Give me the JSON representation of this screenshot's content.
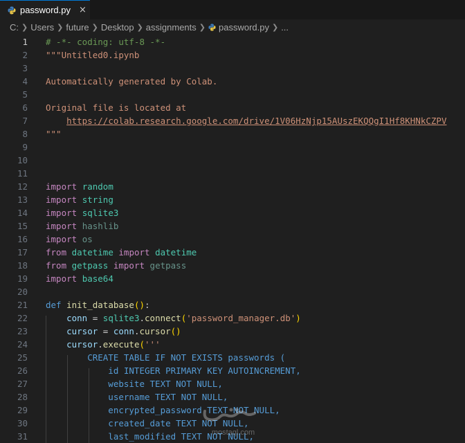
{
  "tab": {
    "filename": "password.py",
    "close_glyph": "×"
  },
  "breadcrumb": [
    "C:",
    "Users",
    "future",
    "Desktop",
    "assignments",
    "password.py",
    "..."
  ],
  "watermark_text": "mostaql.com",
  "colors": {
    "accent": "#0078d4",
    "comment": "#6a9955",
    "string": "#ce9178",
    "keyword": "#c586c0",
    "def": "#569cd6",
    "module": "#4ec9b0",
    "function": "#dcdcaa",
    "variable": "#9cdcfe"
  },
  "lines": [
    {
      "n": "1",
      "tokens": [
        {
          "t": "# -*- coding: utf-8 -*-",
          "c": "c-comment"
        }
      ]
    },
    {
      "n": "2",
      "tokens": [
        {
          "t": "\"\"\"Untitled0.ipynb",
          "c": "c-string"
        }
      ]
    },
    {
      "n": "3",
      "tokens": []
    },
    {
      "n": "4",
      "tokens": [
        {
          "t": "Automatically generated by Colab.",
          "c": "c-string"
        }
      ]
    },
    {
      "n": "5",
      "tokens": []
    },
    {
      "n": "6",
      "tokens": [
        {
          "t": "Original file is located at",
          "c": "c-string"
        }
      ]
    },
    {
      "n": "7",
      "tokens": [
        {
          "t": "    ",
          "c": "c-string"
        },
        {
          "t": "https://colab.research.google.com/drive/1V06HzNjp15AUszEKQQgI1Hf8KHNkCZPV",
          "c": "c-link"
        }
      ]
    },
    {
      "n": "8",
      "tokens": [
        {
          "t": "\"\"\"",
          "c": "c-string"
        }
      ]
    },
    {
      "n": "9",
      "tokens": []
    },
    {
      "n": "10",
      "tokens": []
    },
    {
      "n": "11",
      "tokens": []
    },
    {
      "n": "12",
      "tokens": [
        {
          "t": "import",
          "c": "c-keyword"
        },
        {
          "t": " ",
          "c": "c-plain"
        },
        {
          "t": "random",
          "c": "c-module"
        }
      ]
    },
    {
      "n": "13",
      "tokens": [
        {
          "t": "import",
          "c": "c-keyword"
        },
        {
          "t": " ",
          "c": "c-plain"
        },
        {
          "t": "string",
          "c": "c-module"
        }
      ]
    },
    {
      "n": "14",
      "tokens": [
        {
          "t": "import",
          "c": "c-keyword"
        },
        {
          "t": " ",
          "c": "c-plain"
        },
        {
          "t": "sqlite3",
          "c": "c-module"
        }
      ]
    },
    {
      "n": "15",
      "tokens": [
        {
          "t": "import",
          "c": "c-keyword"
        },
        {
          "t": " ",
          "c": "c-plain"
        },
        {
          "t": "hashlib",
          "c": "c-module-dim"
        }
      ]
    },
    {
      "n": "16",
      "tokens": [
        {
          "t": "import",
          "c": "c-keyword"
        },
        {
          "t": " ",
          "c": "c-plain"
        },
        {
          "t": "os",
          "c": "c-module-dim"
        }
      ]
    },
    {
      "n": "17",
      "tokens": [
        {
          "t": "from",
          "c": "c-keyword"
        },
        {
          "t": " ",
          "c": "c-plain"
        },
        {
          "t": "datetime",
          "c": "c-module"
        },
        {
          "t": " ",
          "c": "c-plain"
        },
        {
          "t": "import",
          "c": "c-keyword"
        },
        {
          "t": " ",
          "c": "c-plain"
        },
        {
          "t": "datetime",
          "c": "c-module"
        }
      ]
    },
    {
      "n": "18",
      "tokens": [
        {
          "t": "from",
          "c": "c-keyword"
        },
        {
          "t": " ",
          "c": "c-plain"
        },
        {
          "t": "getpass",
          "c": "c-module"
        },
        {
          "t": " ",
          "c": "c-plain"
        },
        {
          "t": "import",
          "c": "c-keyword"
        },
        {
          "t": " ",
          "c": "c-plain"
        },
        {
          "t": "getpass",
          "c": "c-module-dim"
        }
      ]
    },
    {
      "n": "19",
      "tokens": [
        {
          "t": "import",
          "c": "c-keyword"
        },
        {
          "t": " ",
          "c": "c-plain"
        },
        {
          "t": "base64",
          "c": "c-module"
        }
      ]
    },
    {
      "n": "20",
      "tokens": []
    },
    {
      "n": "21",
      "tokens": [
        {
          "t": "def",
          "c": "c-def"
        },
        {
          "t": " ",
          "c": "c-plain"
        },
        {
          "t": "init_database",
          "c": "c-func"
        },
        {
          "t": "()",
          "c": "c-paren"
        },
        {
          "t": ":",
          "c": "c-plain"
        }
      ]
    },
    {
      "n": "22",
      "tokens": [
        {
          "t": "    conn",
          "c": "c-var"
        },
        {
          "t": " = ",
          "c": "c-plain"
        },
        {
          "t": "sqlite3",
          "c": "c-module"
        },
        {
          "t": ".",
          "c": "c-plain"
        },
        {
          "t": "connect",
          "c": "c-func"
        },
        {
          "t": "(",
          "c": "c-paren"
        },
        {
          "t": "'password_manager.db'",
          "c": "c-string"
        },
        {
          "t": ")",
          "c": "c-paren"
        }
      ]
    },
    {
      "n": "23",
      "tokens": [
        {
          "t": "    cursor",
          "c": "c-var"
        },
        {
          "t": " = ",
          "c": "c-plain"
        },
        {
          "t": "conn",
          "c": "c-var"
        },
        {
          "t": ".",
          "c": "c-plain"
        },
        {
          "t": "cursor",
          "c": "c-func"
        },
        {
          "t": "()",
          "c": "c-paren"
        }
      ]
    },
    {
      "n": "24",
      "tokens": [
        {
          "t": "    cursor",
          "c": "c-var"
        },
        {
          "t": ".",
          "c": "c-plain"
        },
        {
          "t": "execute",
          "c": "c-func"
        },
        {
          "t": "(",
          "c": "c-paren"
        },
        {
          "t": "'''",
          "c": "c-string"
        }
      ]
    },
    {
      "n": "25",
      "tokens": [
        {
          "t": "        CREATE TABLE IF NOT EXISTS passwords (",
          "c": "c-def"
        }
      ]
    },
    {
      "n": "26",
      "tokens": [
        {
          "t": "            id INTEGER PRIMARY KEY AUTOINCREMENT,",
          "c": "c-def"
        }
      ]
    },
    {
      "n": "27",
      "tokens": [
        {
          "t": "            website TEXT NOT NULL,",
          "c": "c-def"
        }
      ]
    },
    {
      "n": "28",
      "tokens": [
        {
          "t": "            username TEXT NOT NULL,",
          "c": "c-def"
        }
      ]
    },
    {
      "n": "29",
      "tokens": [
        {
          "t": "            encrypted_password TEXT NOT NULL,",
          "c": "c-def"
        }
      ]
    },
    {
      "n": "30",
      "tokens": [
        {
          "t": "            created_date TEXT NOT NULL,",
          "c": "c-def"
        }
      ]
    },
    {
      "n": "31",
      "tokens": [
        {
          "t": "            last_modified TEXT NOT NULL,",
          "c": "c-def"
        }
      ]
    }
  ]
}
